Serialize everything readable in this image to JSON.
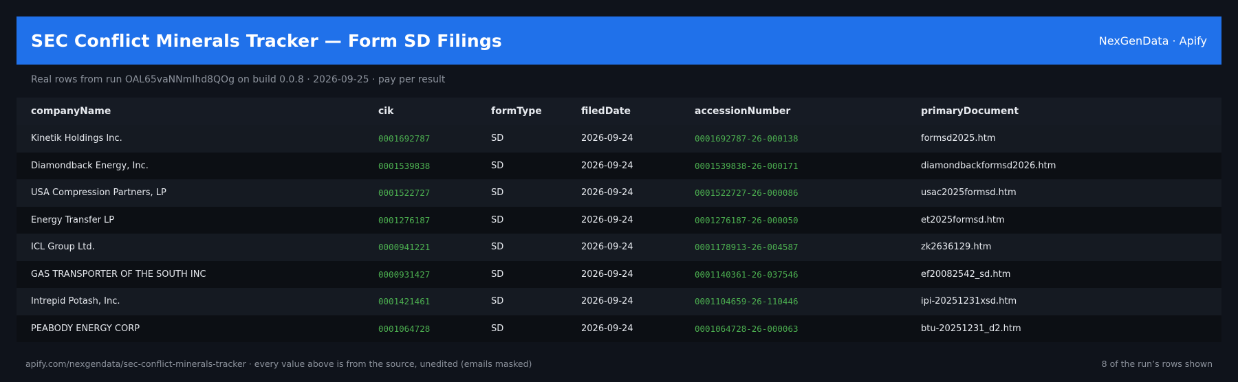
{
  "header": {
    "title": "SEC Conflict Minerals Tracker — Form SD Filings",
    "brand": "NexGenData · Apify"
  },
  "subtitle": "Real rows from run OAL65vaNNmIhd8QOg on build 0.0.8 · 2026-09-25 · pay per result",
  "table": {
    "columns": [
      "companyName",
      "cik",
      "formType",
      "filedDate",
      "accessionNumber",
      "primaryDocument"
    ],
    "rows": [
      [
        "Kinetik Holdings Inc.",
        "0001692787",
        "SD",
        "2026-09-24",
        "0001692787-26-000138",
        "formsd2025.htm"
      ],
      [
        "Diamondback Energy, Inc.",
        "0001539838",
        "SD",
        "2026-09-24",
        "0001539838-26-000171",
        "diamondbackformsd2026.htm"
      ],
      [
        "USA Compression Partners, LP",
        "0001522727",
        "SD",
        "2026-09-24",
        "0001522727-26-000086",
        "usac2025formsd.htm"
      ],
      [
        "Energy Transfer LP",
        "0001276187",
        "SD",
        "2026-09-24",
        "0001276187-26-000050",
        "et2025formsd.htm"
      ],
      [
        "ICL Group Ltd.",
        "0000941221",
        "SD",
        "2026-09-24",
        "0001178913-26-004587",
        "zk2636129.htm"
      ],
      [
        "GAS TRANSPORTER OF THE SOUTH INC",
        "0000931427",
        "SD",
        "2026-09-24",
        "0001140361-26-037546",
        "ef20082542_sd.htm"
      ],
      [
        "Intrepid Potash, Inc.",
        "0001421461",
        "SD",
        "2026-09-24",
        "0001104659-26-110446",
        "ipi-20251231xsd.htm"
      ],
      [
        "PEABODY ENERGY CORP",
        "0001064728",
        "SD",
        "2026-09-24",
        "0001064728-26-000063",
        "btu-20251231_d2.htm"
      ]
    ]
  },
  "footer": {
    "left": "apify.com/nexgendata/sec-conflict-minerals-tracker  ·  every value above is from the source, unedited (emails masked)",
    "right": "8 of the run’s rows shown"
  },
  "colors": {
    "accent": "#2071ea",
    "mono_green": "#4caf50",
    "background": "#0f131b"
  }
}
